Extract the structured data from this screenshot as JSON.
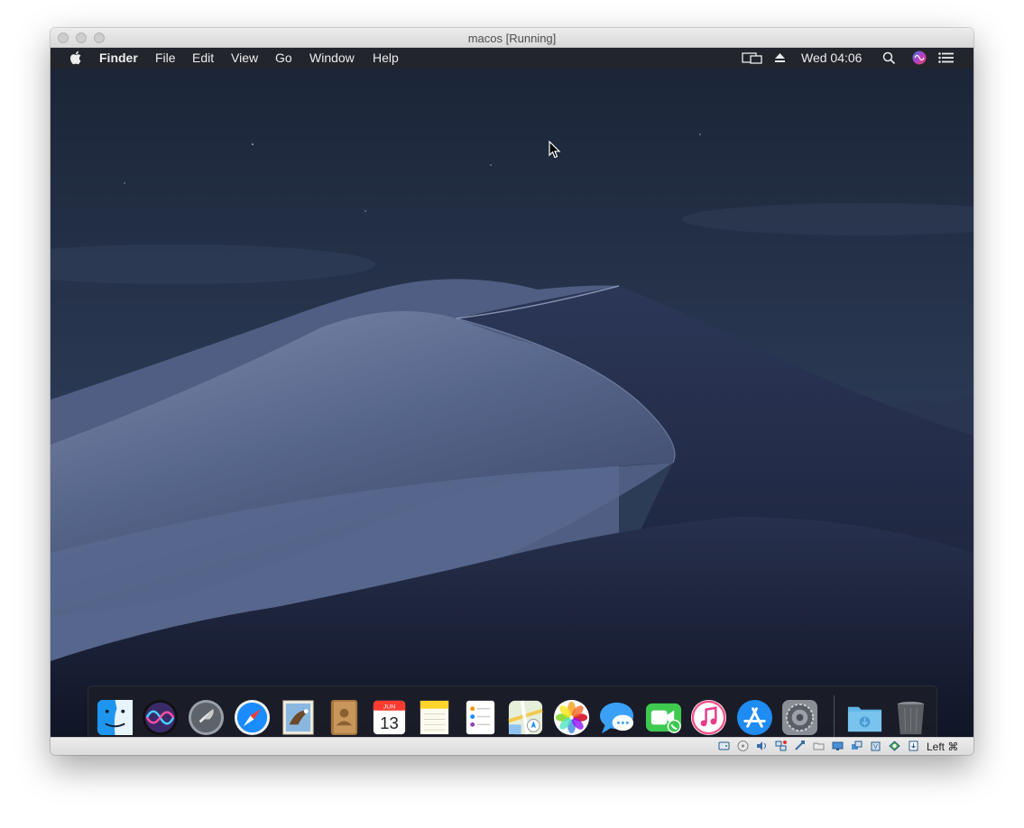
{
  "window": {
    "title": "macos [Running]"
  },
  "menubar": {
    "items": [
      "Finder",
      "File",
      "Edit",
      "View",
      "Go",
      "Window",
      "Help"
    ],
    "clock": "Wed 04:06",
    "status_icons": [
      "screen-mirroring-icon",
      "eject-icon",
      "spotlight-search-icon",
      "siri-icon",
      "notification-center-icon"
    ]
  },
  "dock": {
    "apps": [
      "Finder",
      "Siri",
      "Launchpad",
      "Safari",
      "Mail",
      "Contacts",
      "Calendar",
      "Notes",
      "Reminders",
      "Maps",
      "Photos",
      "Messages",
      "FaceTime",
      "iTunes",
      "App Store",
      "System Preferences",
      "Downloads",
      "Trash"
    ],
    "calendar_month": "JUN",
    "calendar_day": "13"
  },
  "statusbar": {
    "host_key": "Left ⌘",
    "icons": [
      "hard-disk-icon",
      "optical-drive-icon",
      "audio-icon",
      "network-icon",
      "usb-icon",
      "shared-folders-icon",
      "display-icon",
      "video-capture-icon",
      "recording-icon",
      "cpu-icon",
      "guest-additions-icon",
      "mouse-integration-icon"
    ]
  },
  "colors": {
    "menubar_bg": "#23252c",
    "sky_top": "#1b2436",
    "sky_bottom": "#2b3a55",
    "dune_light": "#6c7ea3",
    "dune_dark": "#1a2139"
  }
}
